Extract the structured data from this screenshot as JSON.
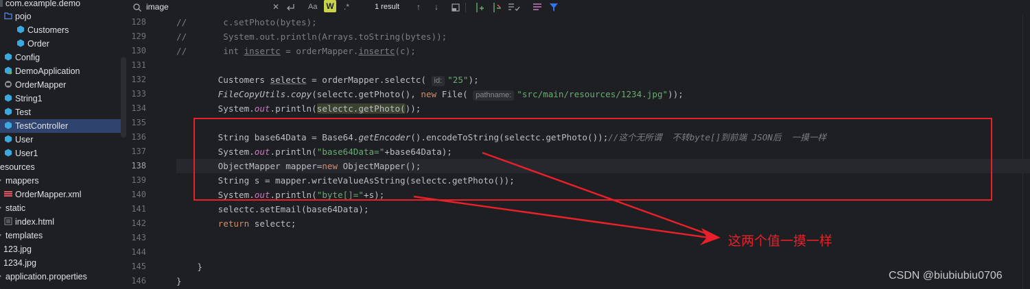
{
  "sidebar": {
    "items": [
      {
        "label": "com.example.demo",
        "icon": "package-icon"
      },
      {
        "label": "pojo",
        "icon": "folder-icon"
      },
      {
        "label": "Customers",
        "icon": "class-icon"
      },
      {
        "label": "Order",
        "icon": "class-icon"
      },
      {
        "label": "Config",
        "icon": "class-icon"
      },
      {
        "label": "DemoApplication",
        "icon": "spring-class-icon"
      },
      {
        "label": "OrderMapper",
        "icon": "mapper-icon"
      },
      {
        "label": "String1",
        "icon": "class-icon"
      },
      {
        "label": "Test",
        "icon": "class-icon"
      },
      {
        "label": "TestController",
        "icon": "class-icon",
        "selected": true
      },
      {
        "label": "User",
        "icon": "class-icon"
      },
      {
        "label": "User1",
        "icon": "class-icon"
      },
      {
        "label": "esources",
        "icon": "folder-icon"
      },
      {
        "label": "mappers",
        "icon": "folder-icon"
      },
      {
        "label": "OrderMapper.xml",
        "icon": "xml-file-icon"
      },
      {
        "label": "static",
        "icon": "folder-icon"
      },
      {
        "label": "index.html",
        "icon": "html-file-icon"
      },
      {
        "label": "templates",
        "icon": "folder-icon"
      },
      {
        "label": "123.jpg",
        "icon": "image-file-icon"
      },
      {
        "label": "1234.jpg",
        "icon": "image-file-icon"
      },
      {
        "label": "application.properties",
        "icon": "properties-file-icon"
      }
    ]
  },
  "find_bar": {
    "query": "image",
    "match_case_label": "Aa",
    "words_label": "W",
    "regex_label": ".*",
    "result_count": "1 result"
  },
  "editor": {
    "line_numbers": [
      "128",
      "129",
      "130",
      "131",
      "132",
      "133",
      "134",
      "135",
      "136",
      "137",
      "138",
      "139",
      "140",
      "141",
      "142",
      "143",
      "144",
      "145",
      "146"
    ],
    "current_line": "138",
    "inlay_id": "id:",
    "inlay_pathname": "pathname:"
  },
  "annotation": {
    "text": "这两个值一摸一样",
    "color": "#e8202a"
  },
  "watermark": "CSDN @biubiubiu0706",
  "colors": {
    "background": "#1e1f22",
    "keyword": "#cf8e6d",
    "string": "#6aab73",
    "function": "#56a8f5",
    "comment": "#7a7e85",
    "field": "#c77dbb",
    "selection": "#2e436e"
  }
}
